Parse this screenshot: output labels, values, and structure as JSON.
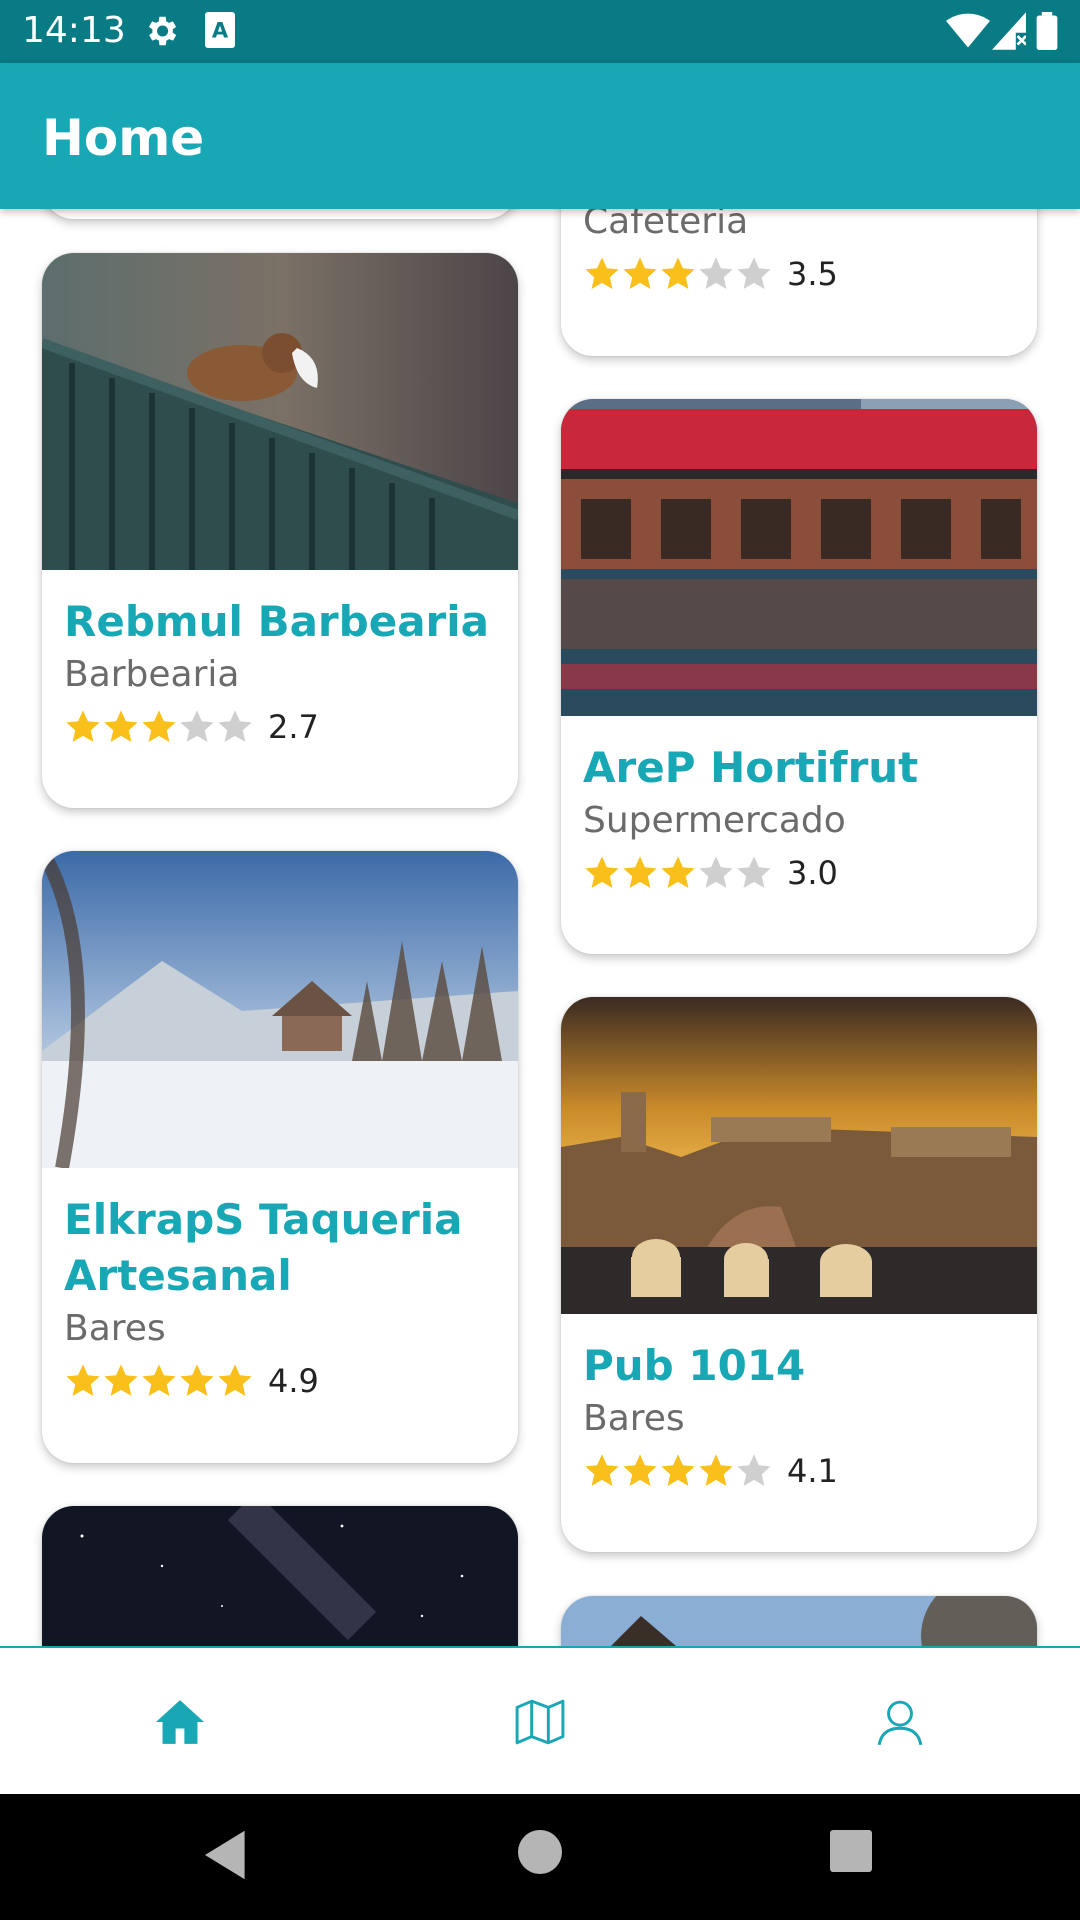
{
  "status_bar": {
    "time": "14:13",
    "icons": [
      "gear-icon",
      "keyboard-a-icon",
      "wifi-icon",
      "signal-icon",
      "battery-icon"
    ]
  },
  "app_bar": {
    "title": "Home"
  },
  "colors": {
    "accent": "#18a7b5",
    "status": "#087b85",
    "star_on": "#f9c01c",
    "star_off": "#cfcfcf"
  },
  "cards": [
    {
      "title": "",
      "category": "Cafeteria",
      "rating": 3.5,
      "rating_text": "3.5",
      "image": "cafe-photo"
    },
    {
      "title": "Rebmul Barbearia",
      "category": "Barbearia",
      "rating": 2.7,
      "rating_text": "2.7",
      "image": "sparrow-photo"
    },
    {
      "title": "AreP Hortifrut",
      "category": "Supermercado",
      "rating": 3.0,
      "rating_text": "3.0",
      "image": "train-bridge-photo"
    },
    {
      "title": "ElkrapS Taqueria Artesanal",
      "category": "Bares",
      "rating": 4.9,
      "rating_text": "4.9",
      "image": "snow-landscape-photo"
    },
    {
      "title": "Pub 1014",
      "category": "Bares",
      "rating": 4.1,
      "rating_text": "4.1",
      "image": "castle-sunset-photo"
    }
  ],
  "bottom_nav": [
    {
      "name": "home",
      "icon": "home-icon",
      "active": true
    },
    {
      "name": "map",
      "icon": "map-icon",
      "active": false
    },
    {
      "name": "profile",
      "icon": "person-icon",
      "active": false
    }
  ]
}
